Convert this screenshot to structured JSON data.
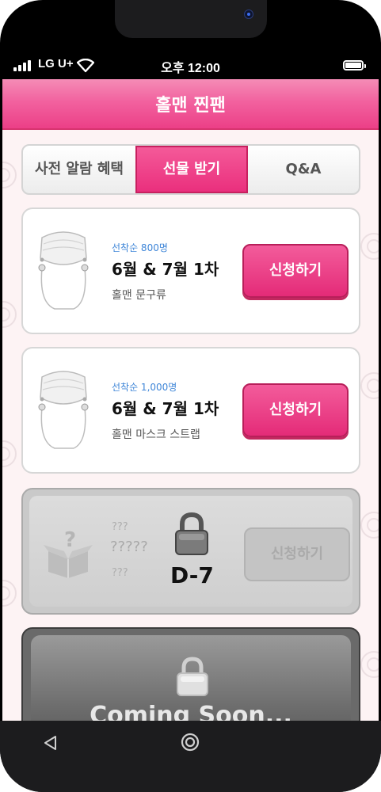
{
  "status_bar": {
    "carrier": "LG U+",
    "time": "오후 12:00"
  },
  "header": {
    "title": "홀맨 찐팬"
  },
  "tabs": [
    {
      "label": "사전 알람 혜택",
      "active": false
    },
    {
      "label": "선물 받기",
      "active": true
    },
    {
      "label": "Q&A",
      "active": false
    }
  ],
  "items": [
    {
      "label": "선착순 800명",
      "title": "6월 & 7월 1차",
      "subtitle": "홀맨 문구류",
      "button": "신청하기",
      "icon": "mask-icon"
    },
    {
      "label": "선착순 1,000명",
      "title": "6월 & 7월 1차",
      "subtitle": "홀맨 마스크 스트랩",
      "button": "신청하기",
      "icon": "mask-icon"
    }
  ],
  "locked_item": {
    "label": "???",
    "title": "?????",
    "subtitle": "???",
    "dday": "D-7",
    "button": "신청하기",
    "icon": "gift-box-icon"
  },
  "coming_soon": {
    "text": "Coming Soon..."
  },
  "colors": {
    "accent": "#ec3f87",
    "label_blue": "#3f86d8",
    "background": "#fdf3f4"
  }
}
